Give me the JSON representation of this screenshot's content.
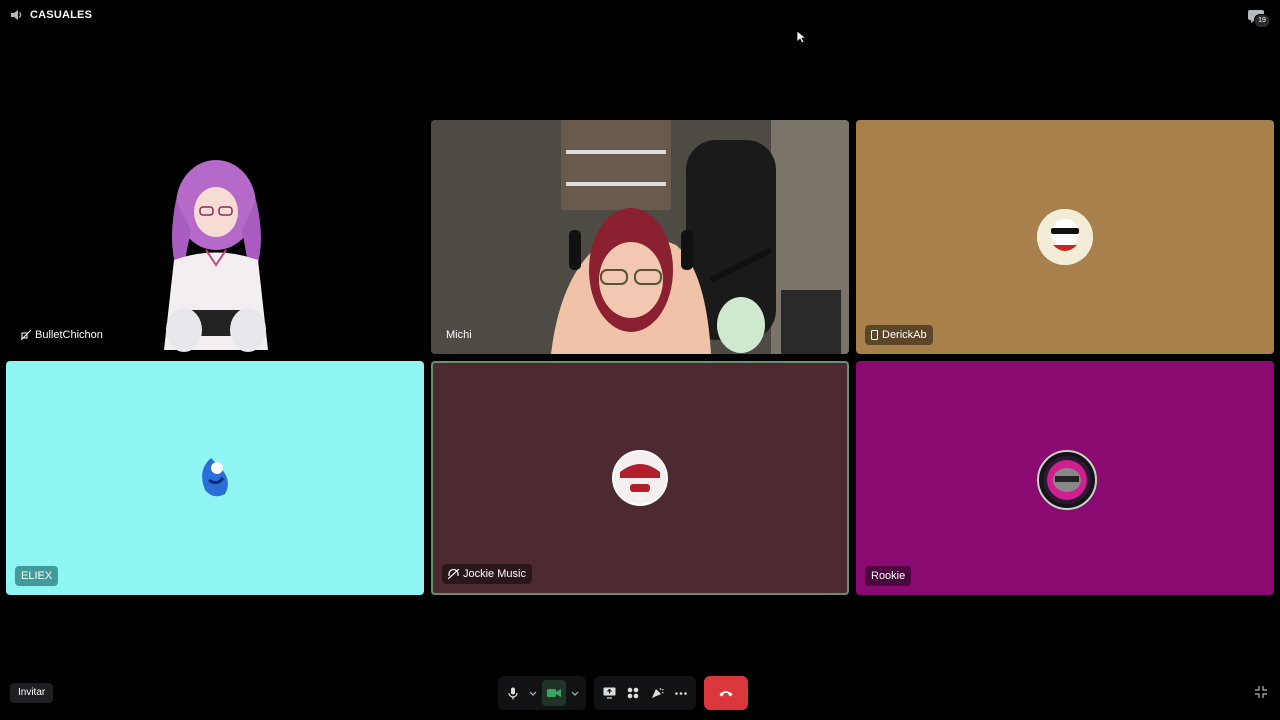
{
  "channel": {
    "name": "CASUALES",
    "icon": "speaker-icon"
  },
  "chat": {
    "icon": "chat-bubble-icon",
    "badge": "19"
  },
  "participants": [
    {
      "name": "BulletChichon",
      "status_icon": "camera-off-icon",
      "bg": "#000000"
    },
    {
      "name": "Michi",
      "bg": "#5a5048"
    },
    {
      "name": "DerickAb",
      "status_icon": "mobile-icon",
      "bg": "#a8804c"
    },
    {
      "name": "ELIEX",
      "bg": "#8ef5f2"
    },
    {
      "name": "Jockie Music",
      "status_icon": "deafened-icon",
      "bg": "#4d2a32"
    },
    {
      "name": "Rookie",
      "bg": "#8a0a72"
    }
  ],
  "controls": {
    "mic": "microphone-icon",
    "mic_options": "chevron-down-icon",
    "camera": "video-camera-icon",
    "camera_options": "chevron-down-icon",
    "screen_share": "screen-share-icon",
    "activities": "activities-icon",
    "soundboard": "soundboard-icon",
    "more": "more-options-icon",
    "disconnect": "hang-up-icon"
  },
  "invite_label": "Invitar",
  "fullscreen_icon": "fullscreen-icon",
  "colors": {
    "accent_green": "#3ba55d",
    "danger": "#da373c"
  }
}
